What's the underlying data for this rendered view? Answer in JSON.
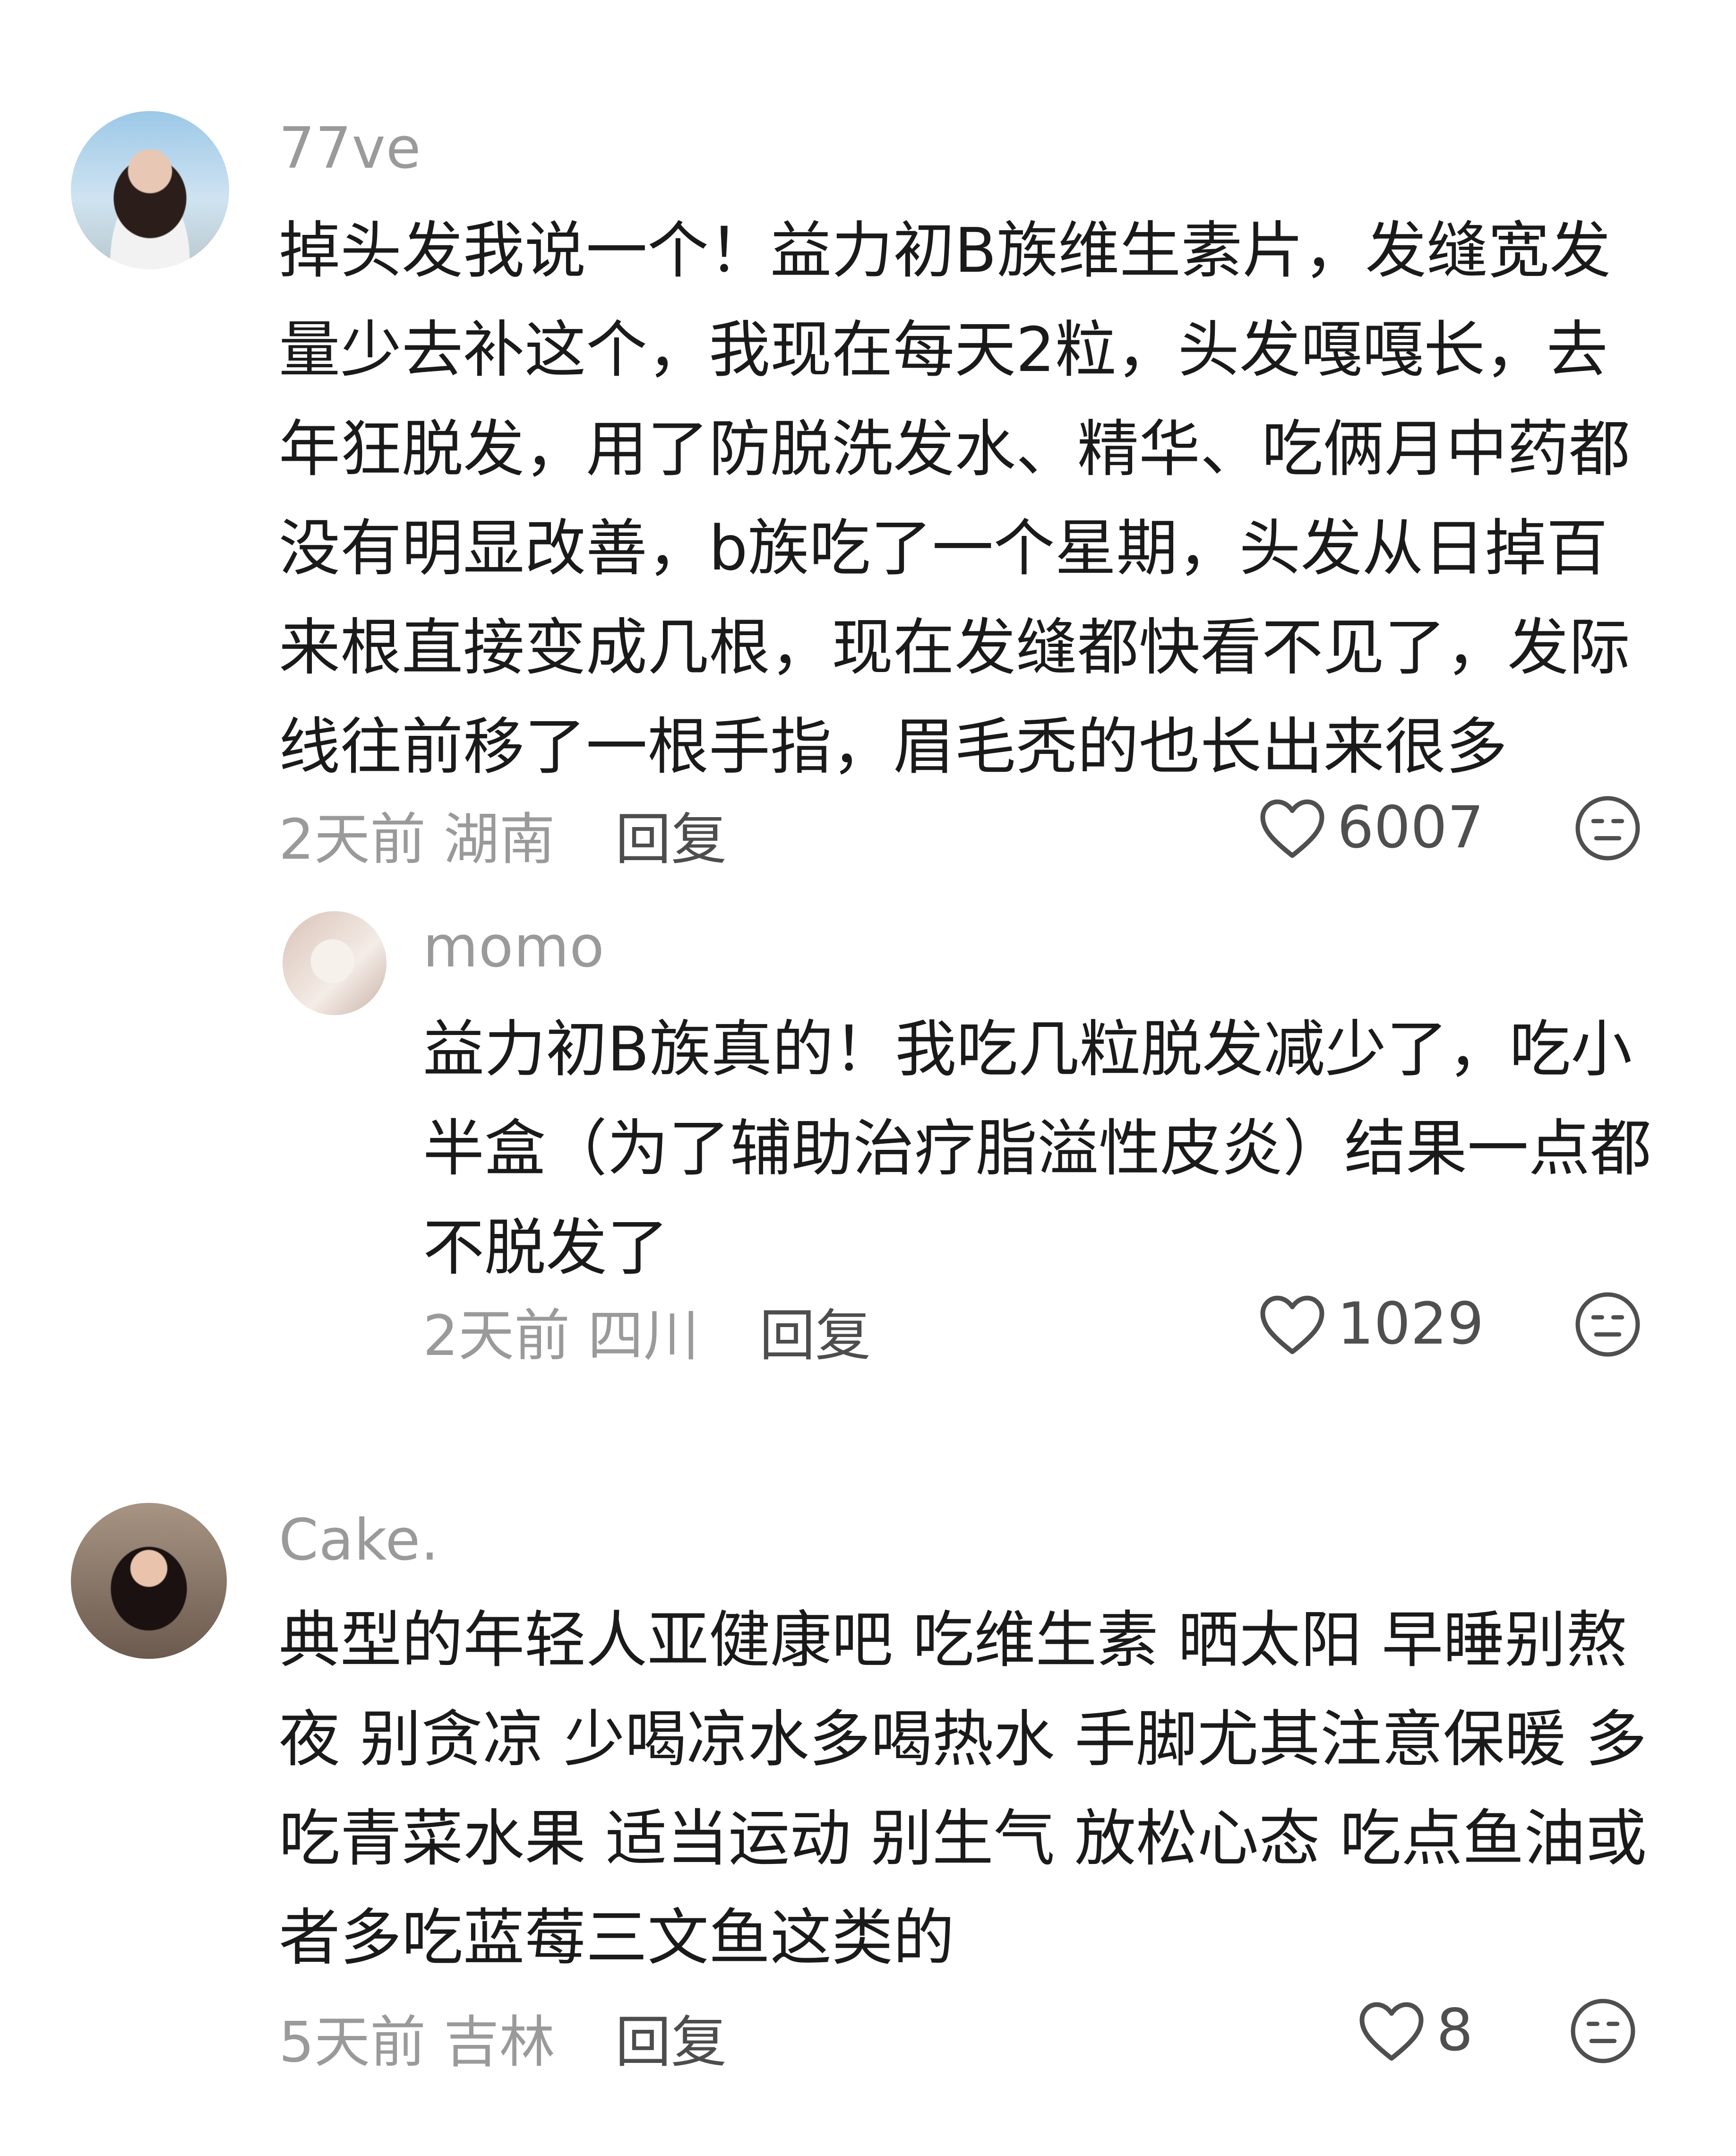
{
  "comments": [
    {
      "username": "77ve",
      "text": "掉头发我说一个！益力初B族维生素片，发缝宽发量少去补这个，我现在每天2粒，头发嘎嘎长，去年狂脱发，用了防脱洗发水、精华、吃俩月中药都没有明显改善，b族吃了一个星期，头发从日掉百来根直接变成几根，现在发缝都快看不见了，发际线往前移了一根手指，眉毛秃的也长出来很多",
      "time": "2天前",
      "location": "湖南",
      "reply_label": "回复",
      "likes": "6007",
      "replies": [
        {
          "username": "momo",
          "text": "益力初B族真的！我吃几粒脱发减少了，吃小半盒（为了辅助治疗脂溢性皮炎）结果一点都不脱发了",
          "time": "2天前",
          "location": "四川",
          "reply_label": "回复",
          "likes": "1029"
        }
      ]
    },
    {
      "username": "Cake.",
      "text": "典型的年轻人亚健康吧 吃维生素 晒太阳 早睡别熬夜 别贪凉 少喝凉水多喝热水 手脚尤其注意保暖 多吃青菜水果 适当运动 别生气 放松心态 吃点鱼油或者多吃蓝莓三文鱼这类的",
      "time": "5天前",
      "location": "吉林",
      "reply_label": "回复",
      "likes": "8"
    }
  ],
  "icons": {
    "like": "heart-outline-icon",
    "react": "neutral-face-icon"
  },
  "colors": {
    "username": "#9a9a9a",
    "text": "#1a1a1a",
    "meta": "#9a9a9a",
    "icon": "#4f4f4f"
  }
}
